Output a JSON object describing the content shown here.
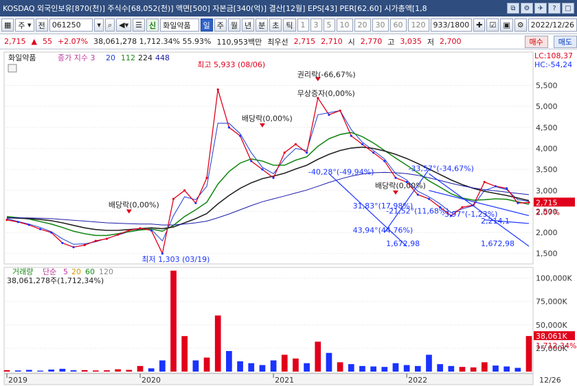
{
  "window": {
    "title": "KOSDAQ 외국인보유[870(천)] 주식수[68,052(천)] 액면[500] 자본금[340(억)] 결산[12월] EPS[43] PER[62.60] 시가총액[1,8",
    "buttons": [
      "⧉",
      "⚙",
      "✈",
      "?",
      "□"
    ]
  },
  "toolbar": {
    "market": "주",
    "prev": "전",
    "code": "061250",
    "name_tag": "신",
    "stock_name": "화일약품",
    "periods": [
      "일",
      "주",
      "월",
      "년",
      "분",
      "초",
      "틱"
    ],
    "active_period": "일",
    "intervals": [
      "1",
      "3",
      "5",
      "10",
      "20",
      "30",
      "60",
      "120"
    ],
    "count": "933",
    "count_total": "/1800",
    "date": "2022/12/26"
  },
  "quote": {
    "price": "2,715",
    "change": "55",
    "change_pct": "+2.07%",
    "volume_info": "38,061,278 1,712.34% 55.93%",
    "amount": "110,953백만",
    "best_ask_label": "최우선",
    "best_ask": "2,715",
    "best_bid": "2,710",
    "open_label": "시",
    "open": "2,770",
    "high_label": "고",
    "high": "3,035",
    "low_label": "저",
    "low": "2,700",
    "buy": "매수",
    "sell": "매도"
  },
  "colors": {
    "up": "#e0001b",
    "down": "#1a33ff",
    "ma20": "#1a3bd6",
    "ma60": "#1a8a1a",
    "ma112": "#222222",
    "ma224": "#1a1aa8",
    "ma448": "#b0b0b0",
    "trend": "#1a33ff",
    "bg": "#ffffff",
    "grid": "#e9e9e9"
  },
  "chart_data": [
    {
      "type": "line",
      "title": "화일약품",
      "legend": {
        "label": "종가 지수 3",
        "ma_periods": [
          "20",
          "112",
          "224",
          "448"
        ]
      },
      "x": [
        "2019-01",
        "2019-02",
        "2019-03",
        "2019-04",
        "2019-05",
        "2019-06",
        "2019-07",
        "2019-08",
        "2019-09",
        "2019-10",
        "2019-11",
        "2019-12",
        "2020-01",
        "2020-02",
        "2020-03",
        "2020-04",
        "2020-05",
        "2020-06",
        "2020-07",
        "2020-08",
        "2020-09",
        "2020-10",
        "2020-11",
        "2020-12",
        "2021-01",
        "2021-02",
        "2021-03",
        "2021-04",
        "2021-05",
        "2021-06",
        "2021-07",
        "2021-08",
        "2021-09",
        "2021-10",
        "2021-11",
        "2021-12",
        "2022-01",
        "2022-02",
        "2022-03",
        "2022-04",
        "2022-05",
        "2022-06",
        "2022-07",
        "2022-08",
        "2022-09",
        "2022-10",
        "2022-11",
        "2022-12"
      ],
      "series": [
        {
          "key": "close",
          "values": [
            2300,
            2250,
            2180,
            2080,
            2000,
            1750,
            1650,
            1700,
            1800,
            1850,
            1950,
            2050,
            2100,
            2050,
            1500,
            2800,
            3000,
            2700,
            3300,
            5400,
            4500,
            4300,
            3700,
            3500,
            3300,
            3900,
            4100,
            3900,
            5200,
            4800,
            4900,
            4300,
            4100,
            3900,
            3700,
            3300,
            3200,
            2900,
            2800,
            2600,
            2400,
            2600,
            2650,
            3200,
            3100,
            3050,
            2700,
            2715
          ]
        },
        {
          "key": "ma20",
          "values": [
            2330,
            2260,
            2200,
            2120,
            2020,
            1850,
            1720,
            1730,
            1780,
            1860,
            1940,
            2020,
            2080,
            2070,
            1800,
            2400,
            2850,
            2780,
            3100,
            4600,
            4600,
            4350,
            3900,
            3550,
            3400,
            3750,
            4000,
            3950,
            4800,
            4850,
            4900,
            4450,
            4150,
            3950,
            3750,
            3400,
            3250,
            2980,
            2850,
            2680,
            2470,
            2560,
            2640,
            3000,
            3090,
            3020,
            2780,
            2740
          ]
        },
        {
          "key": "ma112",
          "values": [
            2380,
            2350,
            2320,
            2260,
            2200,
            2120,
            2030,
            1970,
            1930,
            1930,
            1970,
            2020,
            2060,
            2080,
            2030,
            2170,
            2380,
            2540,
            2720,
            3150,
            3450,
            3650,
            3750,
            3700,
            3600,
            3600,
            3720,
            3800,
            4050,
            4230,
            4330,
            4380,
            4280,
            4130,
            3950,
            3770,
            3600,
            3420,
            3230,
            3080,
            2920,
            2820,
            2770,
            2780,
            2800,
            2790,
            2730,
            2670
          ]
        },
        {
          "key": "ma224",
          "values": [
            2350,
            2340,
            2330,
            2310,
            2280,
            2230,
            2170,
            2110,
            2070,
            2050,
            2050,
            2070,
            2090,
            2110,
            2090,
            2130,
            2230,
            2330,
            2450,
            2680,
            2880,
            3050,
            3180,
            3280,
            3340,
            3410,
            3510,
            3600,
            3740,
            3860,
            3950,
            4010,
            4030,
            4000,
            3940,
            3860,
            3760,
            3640,
            3510,
            3380,
            3250,
            3140,
            3050,
            2980,
            2930,
            2880,
            2820,
            2760
          ]
        },
        {
          "key": "ma448",
          "values": [
            2350,
            2350,
            2345,
            2340,
            2330,
            2310,
            2290,
            2270,
            2250,
            2230,
            2220,
            2210,
            2200,
            2200,
            2180,
            2180,
            2200,
            2230,
            2270,
            2350,
            2440,
            2540,
            2640,
            2730,
            2800,
            2870,
            2940,
            3010,
            3100,
            3190,
            3270,
            3340,
            3390,
            3420,
            3430,
            3420,
            3400,
            3360,
            3300,
            3240,
            3170,
            3110,
            3060,
            3020,
            2990,
            2960,
            2930,
            2900
          ]
        }
      ],
      "ylim": [
        1300,
        5900
      ],
      "yticks": [
        "5,500",
        "5,000",
        "4,500",
        "4,000",
        "3,500",
        "3,000",
        "2,500",
        "2,000",
        "1,500"
      ],
      "y_tick_values": [
        5500,
        5000,
        4500,
        4000,
        3500,
        3000,
        2500,
        2000,
        1500
      ],
      "right_axis": {
        "lc": "LC:108,37",
        "hc": "HC:-54,24",
        "price": "2,715",
        "pct": "2.07%"
      },
      "annotations": [
        {
          "text": "최고 5,933 (08/06)",
          "x": "2020-08",
          "y": 5933,
          "color": "#e0001b"
        },
        {
          "text": "최저 1,303 (03/19)",
          "x": "2020-03",
          "y": 1303,
          "color": "#1a33ff"
        },
        {
          "text": "권리락(-66,67%)",
          "x": "2021-05",
          "y": 5700,
          "color": "#222222"
        },
        {
          "text": "무상증자(0,00%)",
          "x": "2021-05",
          "y": 5250,
          "color": "#222222"
        },
        {
          "text": "배당락(0,00%)",
          "x": "2020-12",
          "y": 4650,
          "color": "#222222"
        },
        {
          "text": "배당락(0,00%)",
          "x": "2019-12",
          "y": 2600,
          "color": "#222222"
        },
        {
          "text": "배당락(0,00%)",
          "x": "2021-12",
          "y": 3050,
          "color": "#222222"
        },
        {
          "text": "-40,28°(-49,94%)",
          "x": "2021-06",
          "y": 3380,
          "color": "#1a33ff"
        },
        {
          "text": "-33,57°(-34,67%)",
          "x": "2022-03",
          "y": 3460,
          "color": "#1a33ff"
        },
        {
          "text": "31,83°(17,98%)",
          "x": "2021-10",
          "y": 2570,
          "color": "#1a33ff"
        },
        {
          "text": "-21,52°(11,68%)",
          "x": "2022-01",
          "y": 2450,
          "color": "#1a33ff"
        },
        {
          "text": "43,94°(44,76%)",
          "x": "2021-10",
          "y": 1990,
          "color": "#1a33ff"
        },
        {
          "text": "1,672,98",
          "x": "2022-01",
          "y": 1672.98,
          "color": "#1a33ff"
        },
        {
          "text": "1,672,98",
          "x": "2022-12",
          "y": 1672.98,
          "color": "#1a33ff"
        },
        {
          "text": "-3,97°(-1,23%)",
          "x": "2022-06",
          "y": 2380,
          "color": "#1a33ff"
        },
        {
          "text": "2,214,1",
          "x": "2022-12",
          "y": 2214.1,
          "color": "#1a33ff"
        }
      ],
      "trendlines": [
        {
          "x1": "2021-06",
          "y1": 3400,
          "x2": "2022-01",
          "y2": 1672.98
        },
        {
          "x1": "2021-11",
          "y1": 2000,
          "x2": "2022-03",
          "y2": 3500
        },
        {
          "x1": "2022-03",
          "y1": 3400,
          "x2": "2022-12",
          "y2": 1672.98
        },
        {
          "x1": "2022-03",
          "y1": 3000,
          "x2": "2022-12",
          "y2": 2400
        },
        {
          "x1": "2022-08",
          "y1": 2300,
          "x2": "2022-12",
          "y2": 2214.1
        }
      ],
      "markers": [
        {
          "kind": "down-arrow",
          "x": "2021-05",
          "y": 5600
        },
        {
          "kind": "down-arrow",
          "x": "2020-12",
          "y": 4500
        },
        {
          "kind": "down-arrow",
          "x": "2019-12",
          "y": 2450
        },
        {
          "kind": "down-arrow",
          "x": "2021-12",
          "y": 2900
        }
      ]
    },
    {
      "type": "bar",
      "title": "거래량",
      "legend": {
        "label": "단순",
        "ma_periods": [
          "5",
          "20",
          "60",
          "120"
        ]
      },
      "volume_info": "38,061,278주(1,712,34%)",
      "x": [
        "2019-01",
        "2019-02",
        "2019-03",
        "2019-04",
        "2019-05",
        "2019-06",
        "2019-07",
        "2019-08",
        "2019-09",
        "2019-10",
        "2019-11",
        "2019-12",
        "2020-01",
        "2020-02",
        "2020-03",
        "2020-04",
        "2020-05",
        "2020-06",
        "2020-07",
        "2020-08",
        "2020-09",
        "2020-10",
        "2020-11",
        "2020-12",
        "2021-01",
        "2021-02",
        "2021-03",
        "2021-04",
        "2021-05",
        "2021-06",
        "2021-07",
        "2021-08",
        "2021-09",
        "2021-10",
        "2021-11",
        "2021-12",
        "2022-01",
        "2022-02",
        "2022-03",
        "2022-04",
        "2022-05",
        "2022-06",
        "2022-07",
        "2022-08",
        "2022-09",
        "2022-10",
        "2022-11",
        "2022-12"
      ],
      "values": [
        1500,
        1200,
        1800,
        1000,
        2200,
        3000,
        1400,
        1600,
        1200,
        1400,
        2500,
        1800,
        6000,
        3500,
        12000,
        108000,
        38000,
        12000,
        15000,
        60000,
        22000,
        11000,
        9000,
        7000,
        12000,
        18000,
        14000,
        9000,
        32000,
        20000,
        10000,
        8000,
        6000,
        5500,
        5000,
        9000,
        7000,
        6000,
        18000,
        8000,
        6000,
        5000,
        4500,
        10000,
        6500,
        5500,
        4000,
        38061
      ],
      "ylim": [
        0,
        110000
      ],
      "yticks": [
        "100,000K",
        "75,000K",
        "50,000K",
        "25,000K"
      ],
      "y_tick_values": [
        100000,
        75000,
        50000,
        25000
      ],
      "current_label": "38,061K",
      "current_pct": "1,712,34%"
    }
  ],
  "x_axis": {
    "labels": [
      "2019",
      "2020",
      "2021",
      "2022"
    ],
    "right_label": "12/26"
  }
}
